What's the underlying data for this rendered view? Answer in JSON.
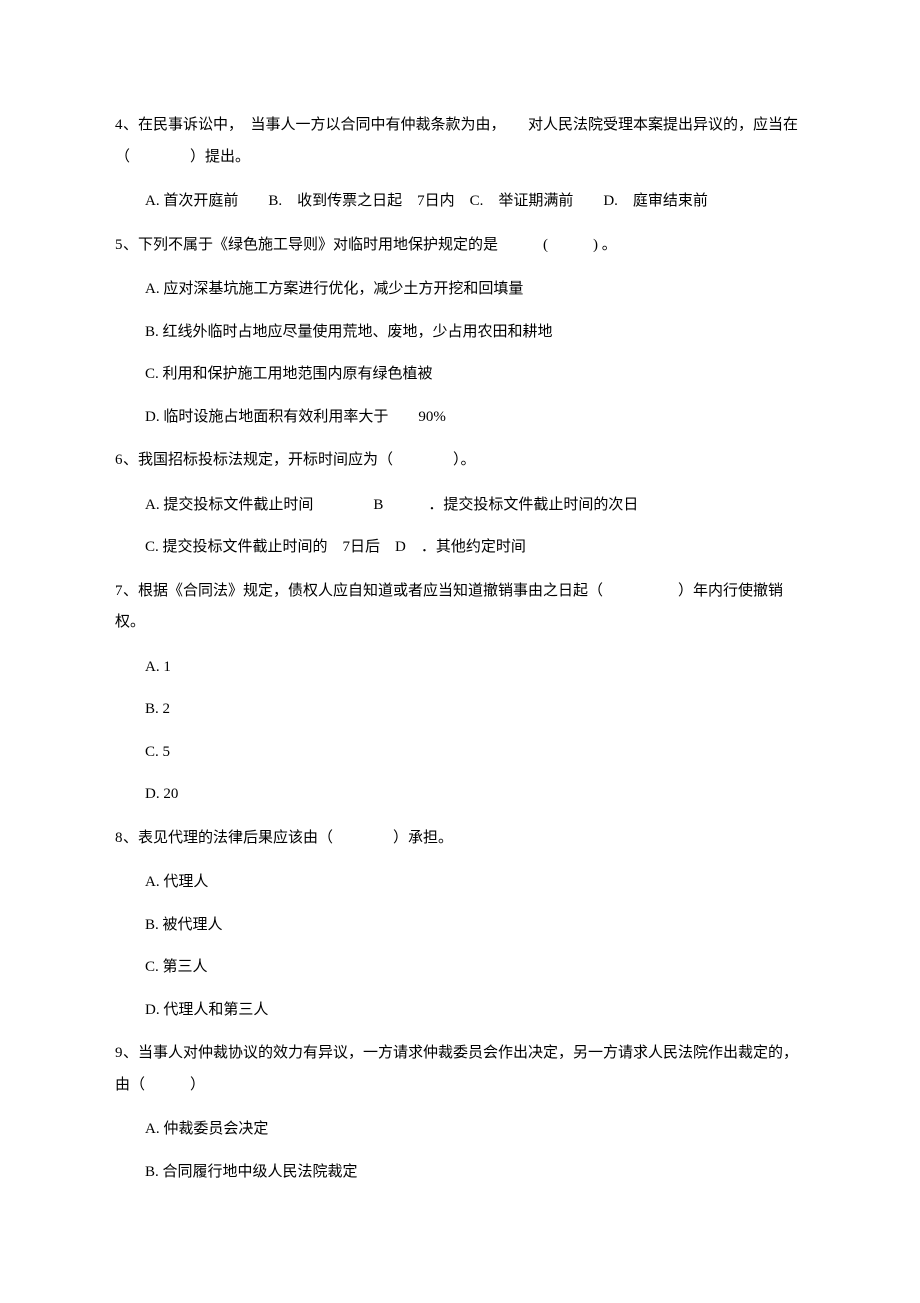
{
  "questions": [
    {
      "num": "4",
      "text": "、在民事诉讼中，　当事人一方以合同中有仲裁条款为由，　　对人民法院受理本案提出异议的，应当在（　　　　）提出。",
      "inline_options": "A. 首次开庭前　　B.　收到传票之日起　7日内　C.　举证期满前　　D.　庭审结束前"
    },
    {
      "num": "5",
      "text": "、下列不属于《绿色施工导则》对临时用地保护规定的是　　　(　　　)  。",
      "options": [
        "A. 应对深基坑施工方案进行优化，减少土方开挖和回填量",
        "B. 红线外临时占地应尽量使用荒地、废地，少占用农田和耕地",
        "C. 利用和保护施工用地范围内原有绿色植被",
        "D. 临时设施占地面积有效利用率大于　　90%"
      ]
    },
    {
      "num": "6",
      "text": "、我国招标投标法规定，开标时间应为（　　　　）。",
      "option_rows": [
        "A.  提交投标文件截止时间　　　　B　　　．提交投标文件截止时间的次日",
        "C.  提交投标文件截止时间的　7日后　D　．其他约定时间"
      ]
    },
    {
      "num": "7",
      "text": "、根据《合同法》规定，债权人应自知道或者应当知道撤销事由之日起（　　　　　）年内行使撤销权。",
      "options": [
        "A.   1",
        "B.   2",
        "C.   5",
        "D.   20"
      ]
    },
    {
      "num": "8",
      "text": "、表见代理的法律后果应该由（　　　　）承担。",
      "options": [
        "A. 代理人",
        "B. 被代理人",
        "C. 第三人",
        "D. 代理人和第三人"
      ]
    },
    {
      "num": "9",
      "text": "、当事人对仲裁协议的效力有异议，一方请求仲裁委员会作出决定，另一方请求人民法院作出裁定的，由（　　　）",
      "options": [
        "A.  仲裁委员会决定",
        "B.  合同履行地中级人民法院裁定"
      ]
    }
  ]
}
